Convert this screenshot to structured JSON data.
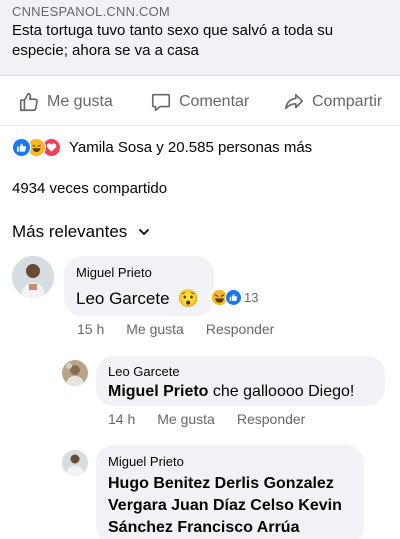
{
  "link_preview": {
    "source": "CNNESPANOL.CNN.COM",
    "title_line1": "Esta tortuga tuvo tanto sexo que salvó a toda su",
    "title_line2": "especie; ahora se va a casa"
  },
  "actions": {
    "like": "Me gusta",
    "comment": "Comentar",
    "share": "Compartir"
  },
  "reactions": {
    "summary": "Yamila Sosa y 20.585 personas más",
    "icons": [
      "like-icon",
      "haha-icon",
      "love-icon"
    ]
  },
  "shares": "4934 veces compartido",
  "sort_label": "Más relevantes",
  "comments": [
    {
      "author": "Miguel Prieto",
      "text": "Leo Garcete",
      "emoji": "😯",
      "reaction_count": "13",
      "time": "15 h",
      "like": "Me gusta",
      "reply": "Responder"
    },
    {
      "author": "Leo Garcete",
      "mention": "Miguel Prieto",
      "text": " che galloooo Diego!",
      "time": "14 h",
      "like": "Me gusta",
      "reply": "Responder"
    },
    {
      "author": "Miguel Prieto",
      "line1": "Hugo Benitez Derlis Gonzalez",
      "line2": "Vergara Juan Díaz Celso Kevin",
      "line3": "Sánchez Francisco Arrúa"
    }
  ],
  "colors": {
    "accent": "#1877f2",
    "haha": "#f7b928",
    "love": "#f33e58",
    "muted": "#65676b",
    "bubble": "#f0f2f5"
  }
}
